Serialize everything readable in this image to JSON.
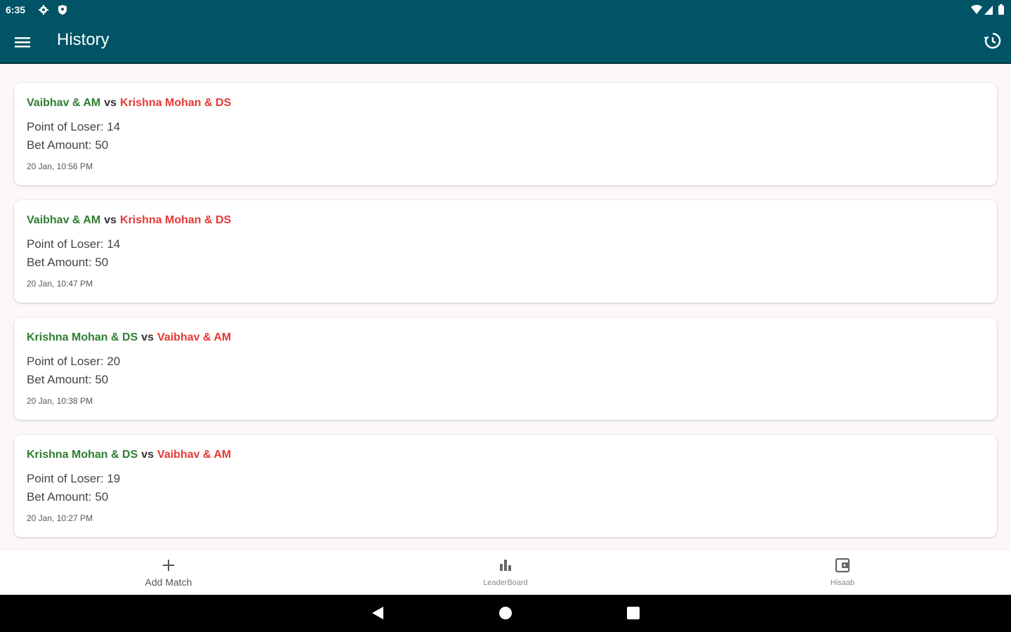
{
  "status_bar": {
    "time": "6:35"
  },
  "app_bar": {
    "title": "History"
  },
  "matches": [
    {
      "winner": "Vaibhav & AM",
      "vs": "vs",
      "loser": "Krishna Mohan  & DS",
      "points_label": "Point of Loser: 14",
      "bet_label": "Bet Amount: 50",
      "timestamp": "20 Jan, 10:56 PM"
    },
    {
      "winner": "Vaibhav & AM",
      "vs": "vs",
      "loser": "Krishna Mohan  & DS",
      "points_label": "Point of Loser: 14",
      "bet_label": "Bet Amount: 50",
      "timestamp": "20 Jan, 10:47 PM"
    },
    {
      "winner": "Krishna Mohan  & DS",
      "vs": "vs",
      "loser": "Vaibhav & AM",
      "points_label": "Point of Loser: 20",
      "bet_label": "Bet Amount: 50",
      "timestamp": "20 Jan, 10:38 PM"
    },
    {
      "winner": "Krishna Mohan  & DS",
      "vs": "vs",
      "loser": "Vaibhav & AM",
      "points_label": "Point of Loser: 19",
      "bet_label": "Bet Amount: 50",
      "timestamp": "20 Jan, 10:27 PM"
    }
  ],
  "bottom_nav": {
    "add_match": "Add Match",
    "leaderboard": "LeaderBoard",
    "hisaab": "Hisaab"
  },
  "colors": {
    "primary": "#005466",
    "winner": "#2e7d32",
    "loser": "#e53935",
    "background": "#fcf7fb"
  }
}
